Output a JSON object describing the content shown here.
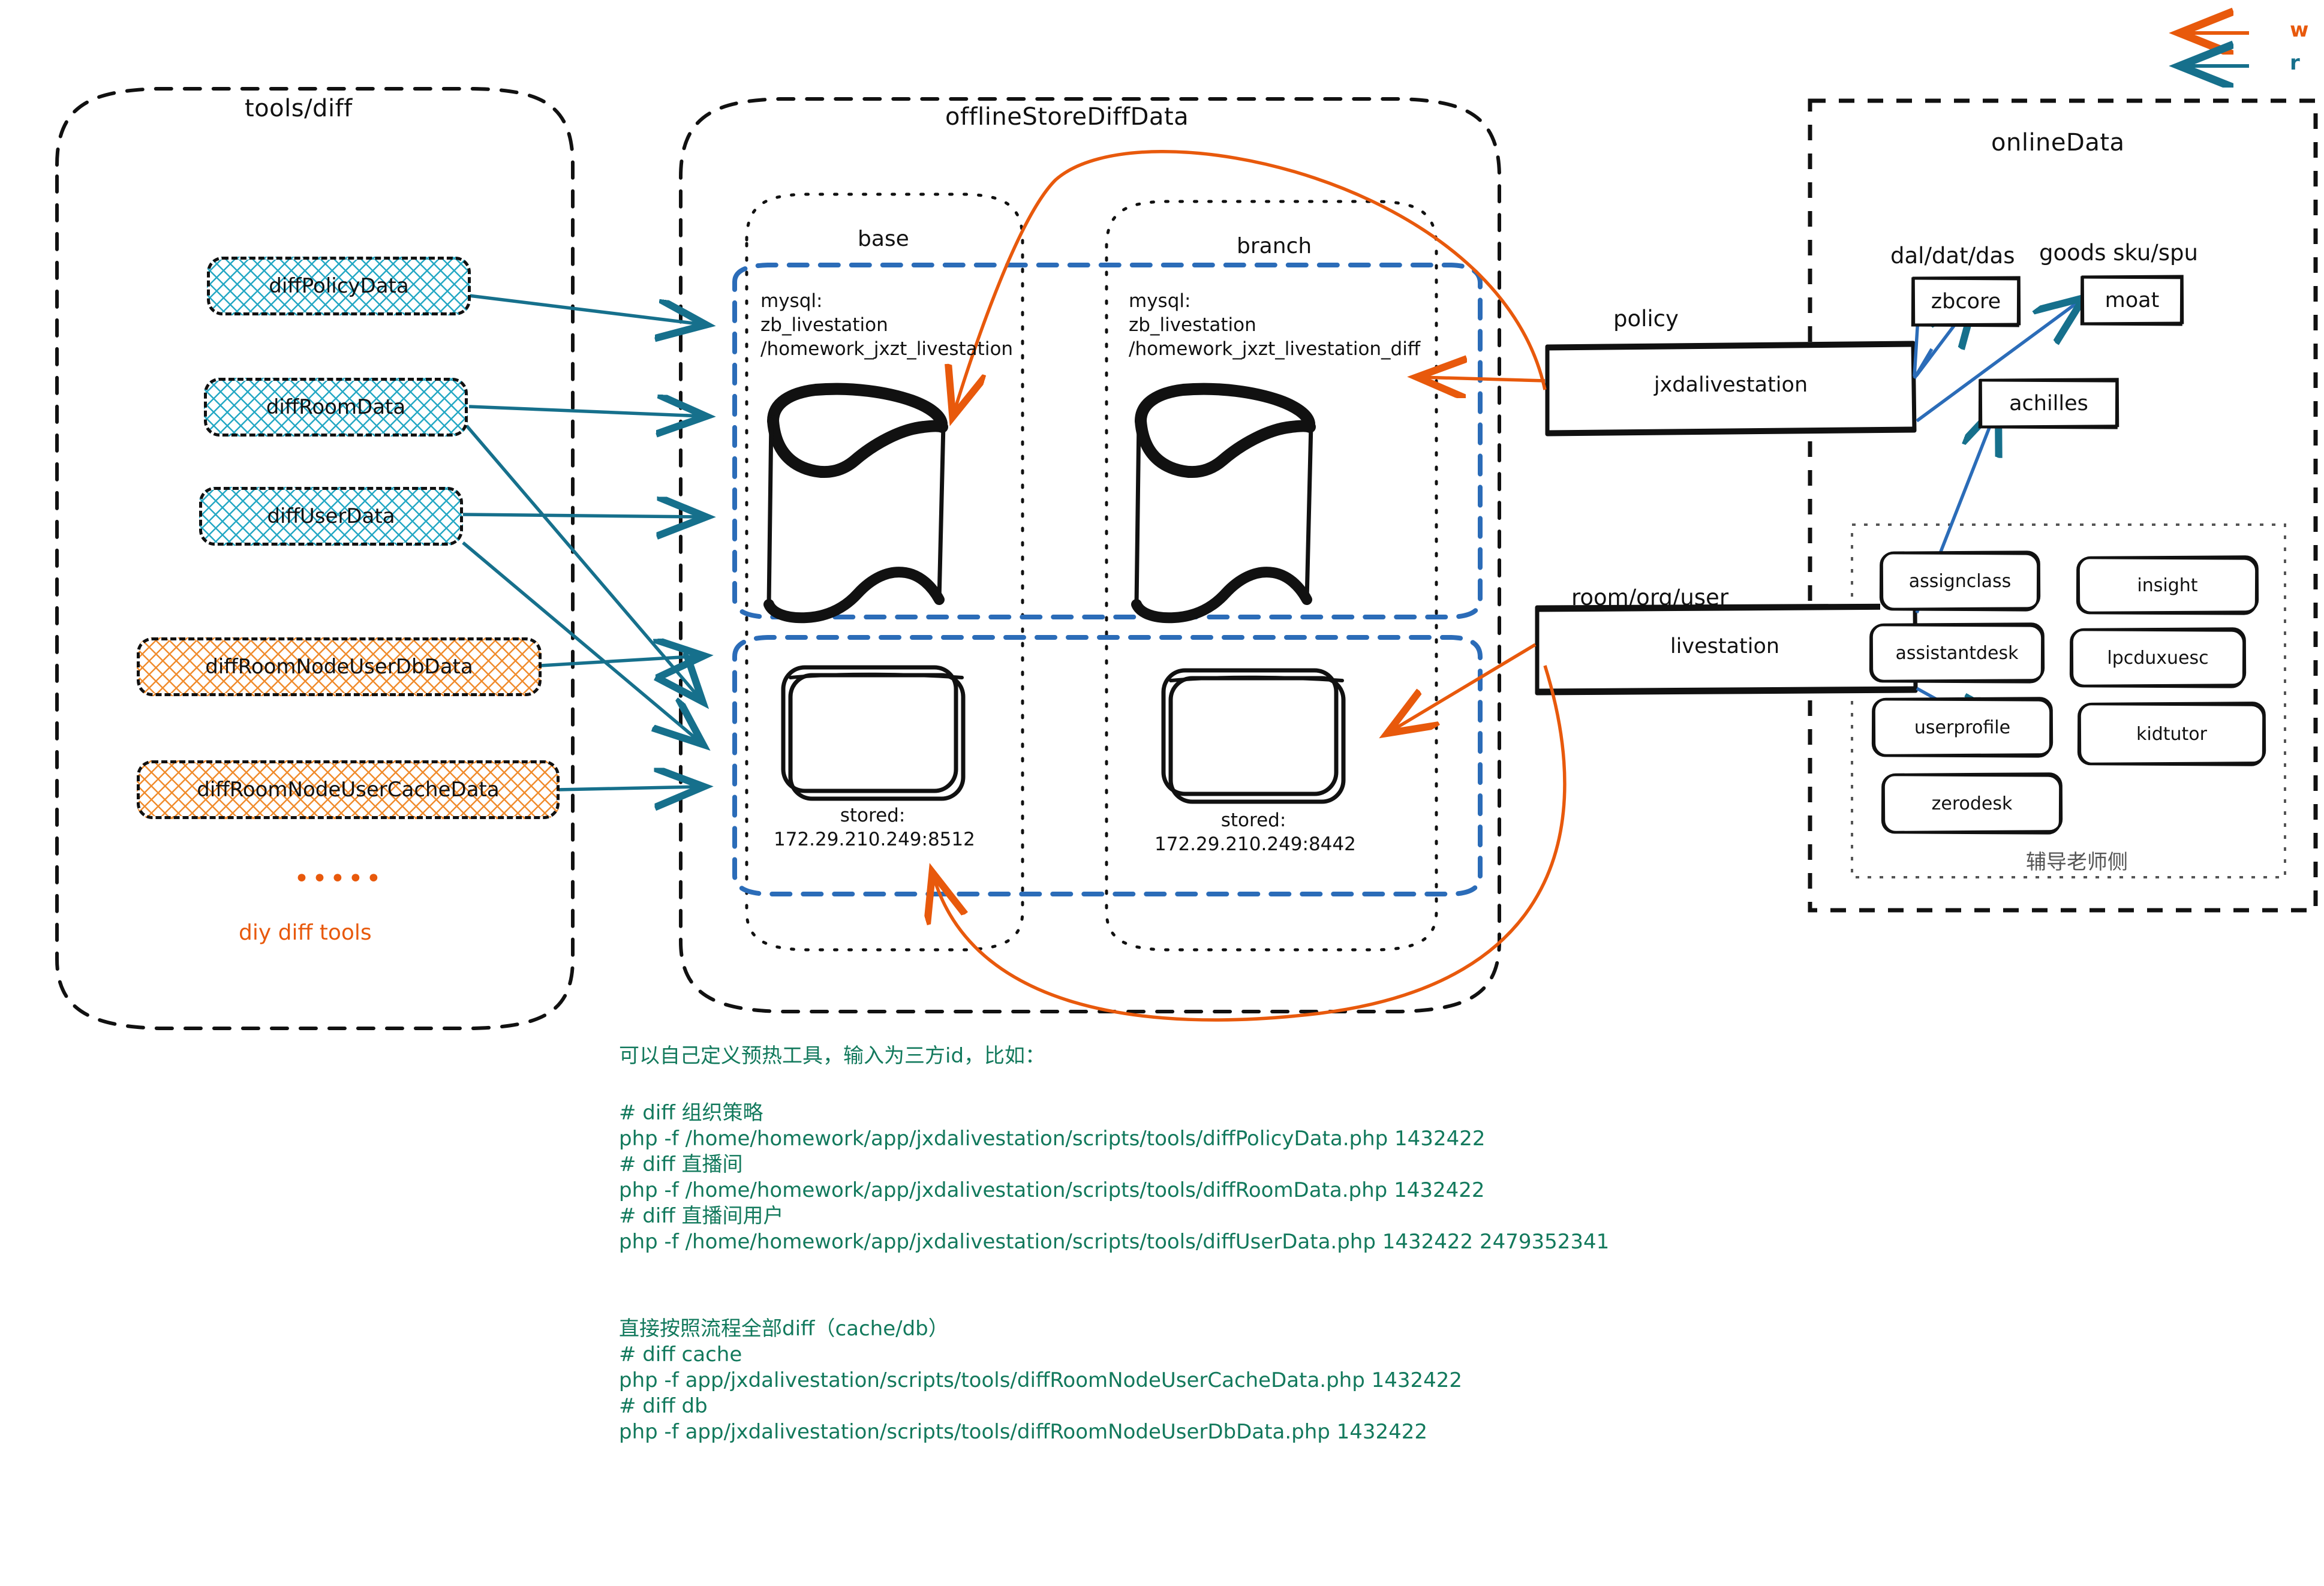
{
  "legend": {
    "items": [
      {
        "label": "w",
        "color": "#e8590c",
        "meaning": "write-arrow"
      },
      {
        "label": "r",
        "color": "#16708c",
        "meaning": "read-arrow"
      }
    ]
  },
  "groups": {
    "tools": {
      "title": "tools/diff",
      "boxes": [
        {
          "label": "diffPolicyData",
          "style": "cyan"
        },
        {
          "label": "diffRoomData",
          "style": "cyan"
        },
        {
          "label": "diffUserData",
          "style": "cyan"
        },
        {
          "label": "diffRoomNodeUserDbData",
          "style": "orange"
        },
        {
          "label": "diffRoomNodeUserCacheData",
          "style": "orange"
        }
      ],
      "ellipsis": "•••••",
      "footer": "diy diff tools"
    },
    "offline": {
      "title": "offlineStoreDiffData",
      "columns": [
        {
          "title": "base",
          "db_lines": "mysql:\nzb_livestation\n/homework_jxzt_livestation",
          "stored_label": "stored:",
          "stored_value": "172.29.210.249:8512"
        },
        {
          "title": "branch",
          "db_lines": "mysql:\nzb_livestation\n/homework_jxzt_livestation_diff",
          "stored_label": "stored:",
          "stored_value": "172.29.210.249:8442"
        }
      ]
    },
    "middle_services": [
      {
        "caption": "policy",
        "label": "jxdalivestation"
      },
      {
        "caption": "room/org/user",
        "label": "livestation"
      }
    ],
    "online": {
      "title": "onlineData",
      "top_nodes": [
        {
          "caption": "dal/dat/das",
          "label": "zbcore"
        },
        {
          "caption": "goods sku/spu",
          "label": "moat"
        }
      ],
      "mid_nodes": [
        {
          "caption": "",
          "label": "achilles"
        }
      ],
      "teacher_panel": {
        "footer": "辅导老师侧",
        "services": [
          "assignclass",
          "insight",
          "assistantdesk",
          "lpcduxuesc",
          "userprofile",
          "kidtutor",
          "zerodesk"
        ]
      }
    }
  },
  "notes": {
    "intro": "可以自己定义预热工具，输入为三方id，比如：",
    "block1": "# diff 组织策略\nphp -f /home/homework/app/jxdalivestation/scripts/tools/diffPolicyData.php 1432422\n# diff 直播间\nphp -f /home/homework/app/jxdalivestation/scripts/tools/diffRoomData.php 1432422\n# diff 直播间用户\nphp -f /home/homework/app/jxdalivestation/scripts/tools/diffUserData.php 1432422 2479352341",
    "block2": "直接按照流程全部diff（cache/db）\n# diff cache\nphp -f app/jxdalivestation/scripts/tools/diffRoomNodeUserCacheData.php 1432422\n# diff db\nphp -f app/jxdalivestation/scripts/tools/diffRoomNodeUserDbData.php 1432422"
  },
  "colors": {
    "write": "#e8590c",
    "read": "#16708c",
    "blue_dash": "#2b6cb8",
    "green_text": "#12795c",
    "cyan_hatch": "#25a8c4",
    "orange_hatch": "#f08c2e"
  }
}
